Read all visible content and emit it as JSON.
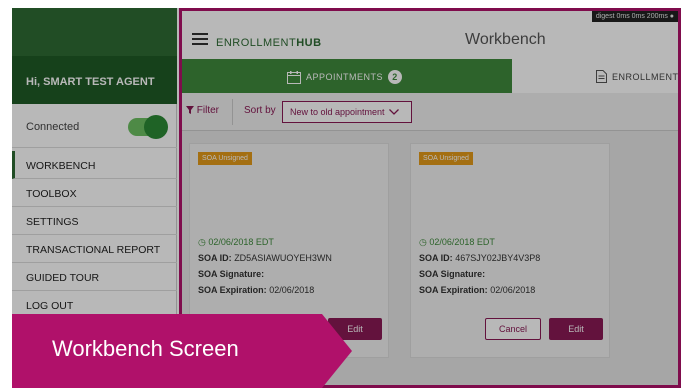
{
  "sidebar": {
    "greeting": "Hi, SMART TEST AGENT",
    "connection_label": "Connected",
    "connection_on": true,
    "items": [
      {
        "label": "WORKBENCH"
      },
      {
        "label": "TOOLBOX"
      },
      {
        "label": "SETTINGS"
      },
      {
        "label": "TRANSACTIONAL REPORT"
      },
      {
        "label": "GUIDED TOUR"
      },
      {
        "label": "LOG OUT"
      }
    ]
  },
  "header": {
    "brand_part1": "ENROLLMENT",
    "brand_part2": "HUB",
    "title": "Workbench",
    "debug": "digest 0ms 0ms 200ms ●"
  },
  "tabs": [
    {
      "label": "APPOINTMENTS",
      "count": "2"
    },
    {
      "label": "ENROLLMENT A"
    }
  ],
  "toolbar": {
    "filter_label": "Filter",
    "sort_label": "Sort by",
    "sort_value": "New to old appointment"
  },
  "cards": [
    {
      "status": "SOA Unsigned",
      "date": "02/06/2018 EDT",
      "soa_id_label": "SOA ID:",
      "soa_id": "ZD5ASIAWUOYEH3WN",
      "signature_label": "SOA Signature:",
      "expiration_label": "SOA Expiration:",
      "expiration": "02/06/2018",
      "edit_label": "Edit"
    },
    {
      "status": "SOA Unsigned",
      "date": "02/06/2018 EDT",
      "soa_id_label": "SOA ID:",
      "soa_id": "467SJY02JBY4V3P8",
      "signature_label": "SOA Signature:",
      "expiration_label": "SOA Expiration:",
      "expiration": "02/06/2018",
      "cancel_label": "Cancel",
      "edit_label": "Edit"
    }
  ],
  "callout": {
    "text": "Workbench Screen",
    "color": "#b0116a"
  },
  "colors": {
    "brand_green": "#2e6b34",
    "accent": "#8a1a55",
    "tag_orange": "#e39a1a"
  }
}
